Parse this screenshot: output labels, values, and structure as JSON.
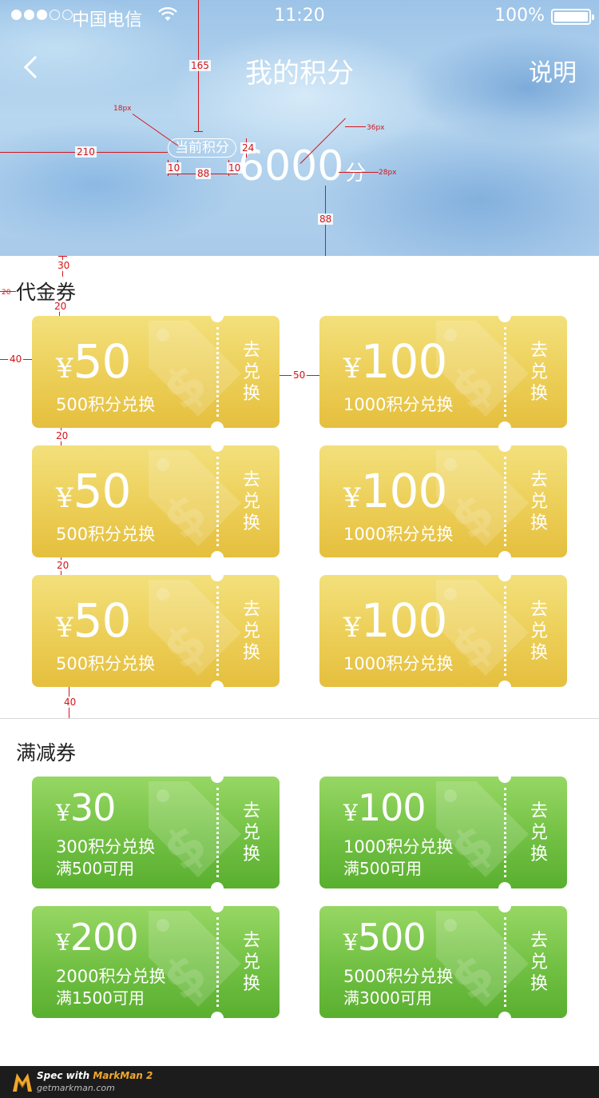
{
  "status_bar": {
    "carrier": "中国电信",
    "time": "11:20",
    "battery": "100%"
  },
  "nav": {
    "title": "我的积分",
    "help": "说明"
  },
  "points": {
    "label": "当前积分",
    "value": "6000",
    "unit": "分"
  },
  "spec_labels": {
    "a165": "165",
    "a18": "18px",
    "a210": "210",
    "a24": "24",
    "a10l": "10",
    "a10r": "10",
    "a88": "88",
    "a36": "36px",
    "a28": "28px",
    "a88b": "88",
    "a30": "30",
    "a20l": "20",
    "a20t": "20",
    "a40": "40",
    "a50": "50",
    "a20r1": "20",
    "a20r2": "20",
    "a40b": "40"
  },
  "sections": {
    "cash": {
      "title": "代金券",
      "coupons": [
        {
          "currency": "¥",
          "amount": "50",
          "cost": "500积分兑换",
          "action": [
            "去",
            "兑",
            "换"
          ]
        },
        {
          "currency": "¥",
          "amount": "100",
          "cost": "1000积分兑换",
          "action": [
            "去",
            "兑",
            "换"
          ]
        },
        {
          "currency": "¥",
          "amount": "50",
          "cost": "500积分兑换",
          "action": [
            "去",
            "兑",
            "换"
          ]
        },
        {
          "currency": "¥",
          "amount": "100",
          "cost": "1000积分兑换",
          "action": [
            "去",
            "兑",
            "换"
          ]
        },
        {
          "currency": "¥",
          "amount": "50",
          "cost": "500积分兑换",
          "action": [
            "去",
            "兑",
            "换"
          ]
        },
        {
          "currency": "¥",
          "amount": "100",
          "cost": "1000积分兑换",
          "action": [
            "去",
            "兑",
            "换"
          ]
        }
      ]
    },
    "discount": {
      "title": "满减券",
      "coupons": [
        {
          "currency": "¥",
          "amount": "30",
          "cost": "300积分兑换",
          "condition": "满500可用",
          "action": [
            "去",
            "兑",
            "换"
          ]
        },
        {
          "currency": "¥",
          "amount": "100",
          "cost": "1000积分兑换",
          "condition": "满500可用",
          "action": [
            "去",
            "兑",
            "换"
          ]
        },
        {
          "currency": "¥",
          "amount": "200",
          "cost": "2000积分兑换",
          "condition": "满1500可用",
          "action": [
            "去",
            "兑",
            "换"
          ]
        },
        {
          "currency": "¥",
          "amount": "500",
          "cost": "5000积分兑换",
          "condition": "满3000可用",
          "action": [
            "去",
            "兑",
            "换"
          ]
        }
      ]
    }
  },
  "footer": {
    "spec_prefix": "Spec with ",
    "brand": "MarkMan 2",
    "url": "getmarkman.com"
  },
  "colors": {
    "gold_top": "#f3e07c",
    "gold_bottom": "#e5bf3e",
    "green_top": "#97d764",
    "green_bottom": "#5aaf2f",
    "annotation": "#d3171a"
  },
  "icons": [
    "back-chevron-icon",
    "wifi-icon",
    "battery-icon",
    "dollar-tag-icon",
    "markman-logo-icon"
  ]
}
